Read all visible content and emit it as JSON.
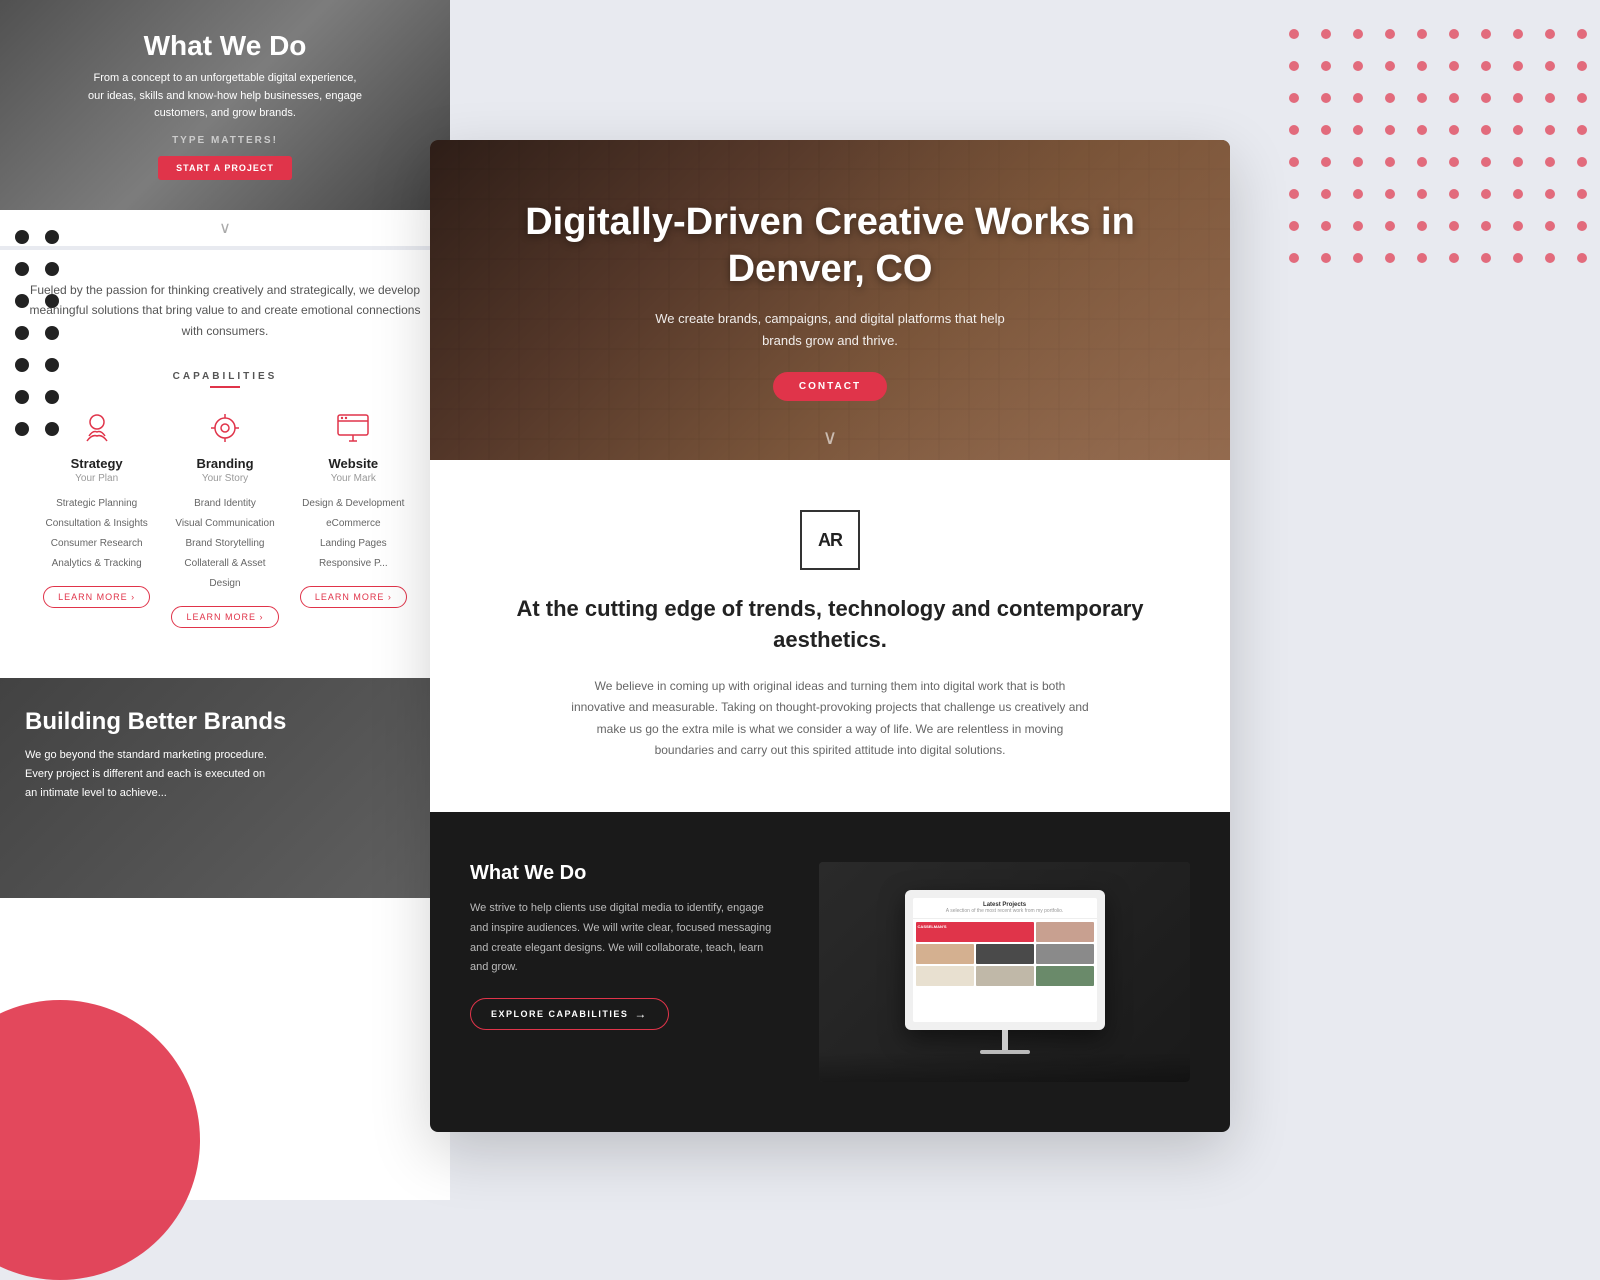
{
  "background": {
    "color": "#e8eaf0"
  },
  "dot_pattern": {
    "color": "#e0344a",
    "rows": 8,
    "cols": 10
  },
  "behind_page": {
    "hero": {
      "title": "What We Do",
      "description": "From a concept to an unforgettable digital experience, our ideas, skills and know-how help businesses, engage customers, and grow brands.",
      "type_matters": "TYPE MATTERS!",
      "cta_label": "START A PROJECT"
    },
    "middle": {
      "text": "Fueled by the passion for thinking creatively and strategically, we develop meaningful solutions that bring value to and create emotional connections with consumers."
    },
    "capabilities": {
      "section_label": "CAPABILITIES",
      "items": [
        {
          "title": "Strategy",
          "subtitle": "Your Plan",
          "list": [
            "Strategic Planning",
            "Consultation & Insights",
            "Consumer Research",
            "Analytics & Tracking"
          ],
          "learn_more": "LEARN MORE"
        },
        {
          "title": "Branding",
          "subtitle": "Your Story",
          "list": [
            "Brand Identity",
            "Visual Communication",
            "Brand Storytelling",
            "Collaterall & Asset Design"
          ],
          "learn_more": "LEARN MORE"
        },
        {
          "title": "Website",
          "subtitle": "Your Mark",
          "list": [
            "Design & Development",
            "eCommerce",
            "Landing Pages",
            "Responsive P..."
          ],
          "learn_more": "LEARN MORE"
        }
      ]
    },
    "bottom": {
      "title": "Building Better Brands",
      "text": "We go beyond the standard marketing procedure. Every project is different and each is executed on an intimate level to achieve..."
    }
  },
  "main_card": {
    "hero": {
      "title": "Digitally-Driven Creative Works in Denver, CO",
      "description": "We create brands, campaigns, and digital platforms that help brands grow and thrive.",
      "cta_label": "CONTACT"
    },
    "middle": {
      "logo_text": "AR",
      "heading": "At the cutting edge of trends, technology and contemporary aesthetics.",
      "body": "We believe in coming up with original ideas and turning them into digital work that is both innovative and measurable. Taking on thought-provoking projects that challenge us creatively and make us go the extra mile is what we consider a way of life. We are relentless in moving boundaries and carry out this spirited attitude into digital solutions."
    },
    "bottom": {
      "what_we_do": {
        "heading": "What We Do",
        "body": "We strive to help clients use digital media to identify, engage and inspire audiences. We will write clear, focused messaging and create elegant designs. We will collaborate, teach, learn and grow.",
        "cta_label": "EXPLORE CAPABILITIES"
      },
      "portfolio": {
        "title": "Latest Projects",
        "subtitle": "A selection of the most recent work from my portfolio.",
        "brand_name": "CASSELMAN'S",
        "cell_colors": [
          "#e0344a",
          "#c0c0c0",
          "#f0e0d0",
          "#4a4a4a",
          "#d0c0b0",
          "#a0a0a0"
        ]
      }
    }
  }
}
